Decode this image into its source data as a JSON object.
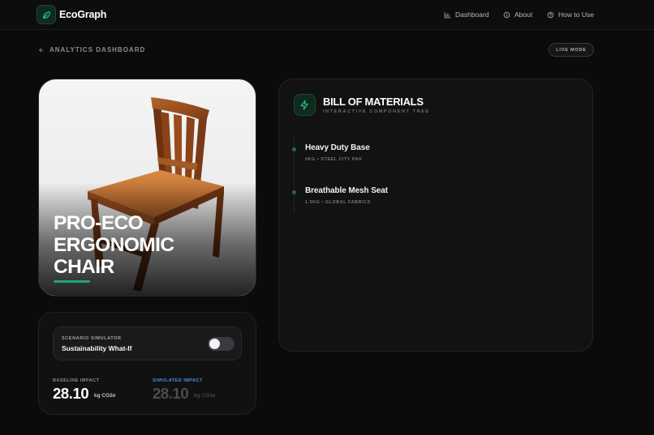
{
  "header": {
    "brand": "EcoGraph",
    "nav": [
      {
        "label": "Dashboard",
        "icon": "bar-chart-icon"
      },
      {
        "label": "About",
        "icon": "info-icon"
      },
      {
        "label": "How to Use",
        "icon": "help-circle-icon"
      }
    ]
  },
  "breadcrumb": {
    "back_label": "ANALYTICS DASHBOARD"
  },
  "badge": {
    "live_mode": "LIVE MODE"
  },
  "product": {
    "title_lines": [
      "PRO-ECO",
      "ERGONOMIC",
      "CHAIR"
    ]
  },
  "simulator": {
    "label": "SCENARIO SIMULATOR",
    "subtitle": "Sustainability What-If",
    "toggle_on": false,
    "baseline": {
      "label": "BASELINE IMPACT",
      "value": "28.10",
      "unit": "kg CO2e"
    },
    "simulated": {
      "label": "SIMULATED IMPACT",
      "value": "28.10",
      "unit": "kg CO2e"
    }
  },
  "bom": {
    "title": "BILL OF MATERIALS",
    "subtitle": "INTERACTIVE COMPONENT TREE",
    "components": [
      {
        "name": "Heavy Duty Base",
        "meta": "0KG • STEEL CITY PAK"
      },
      {
        "name": "Breathable Mesh Seat",
        "meta": "1.5KG • GLOBAL FABRICS"
      }
    ]
  },
  "colors": {
    "accent_green": "#1fa673",
    "simulated_blue": "#4c8ee8",
    "background": "#0b0b0c"
  }
}
